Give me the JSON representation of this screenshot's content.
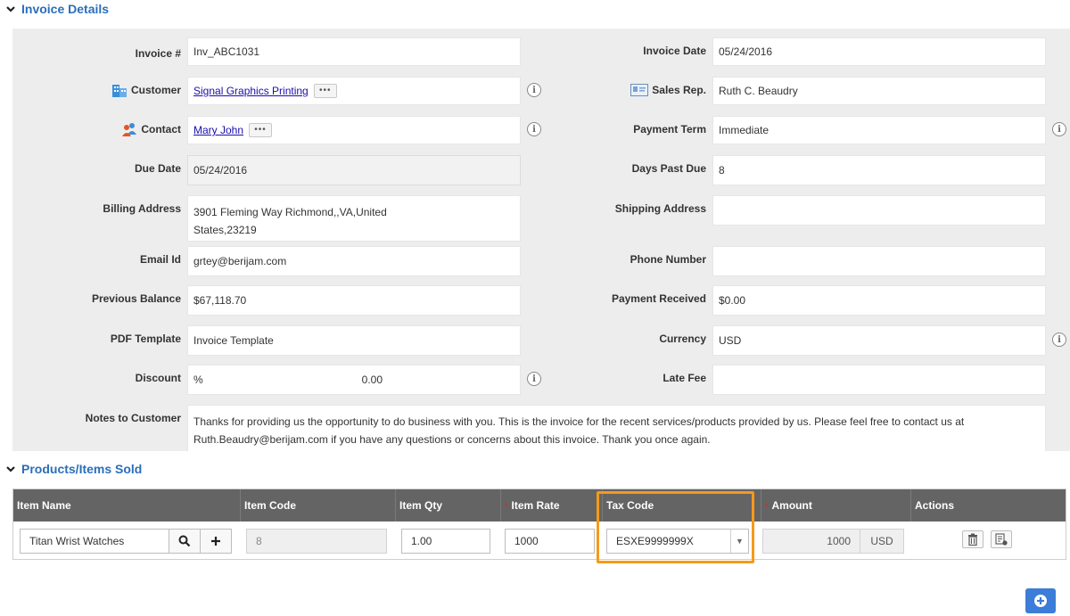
{
  "sections": {
    "invoice_details": "Invoice Details",
    "products_sold": "Products/Items Sold"
  },
  "invoice": {
    "invoice_no_label": "Invoice #",
    "invoice_no": "Inv_ABC1031",
    "invoice_date_label": "Invoice Date",
    "invoice_date": "05/24/2016",
    "customer_label": "Customer",
    "customer": "Signal Graphics Printing",
    "sales_rep_label": "Sales Rep.",
    "sales_rep": "Ruth C. Beaudry",
    "contact_label": "Contact",
    "contact": "Mary John",
    "payment_term_label": "Payment Term",
    "payment_term": "Immediate",
    "due_date_label": "Due Date",
    "due_date": "05/24/2016",
    "days_past_due_label": "Days Past Due",
    "days_past_due": "8",
    "billing_address_label": "Billing Address",
    "billing_address_line1": "3901 Fleming Way Richmond,,VA,United",
    "billing_address_line2": "States,23219",
    "shipping_address_label": "Shipping Address",
    "shipping_address": "",
    "email_label": "Email Id",
    "email": "grtey@berijam.com",
    "phone_label": "Phone Number",
    "phone": "",
    "prev_balance_label": "Previous Balance",
    "prev_balance": "$67,118.70",
    "payment_received_label": "Payment Received",
    "payment_received": "$0.00",
    "pdf_template_label": "PDF Template",
    "pdf_template": "Invoice Template",
    "currency_label": "Currency",
    "currency": "USD",
    "discount_label": "Discount",
    "discount_unit": "%",
    "discount_value": "0.00",
    "late_fee_label": "Late Fee",
    "late_fee": "",
    "notes_label": "Notes to Customer",
    "notes_line1": "Thanks for providing us the opportunity to do business with you. This is the invoice for the recent services/products provided by us. Please feel free to contact us at",
    "notes_line2": "Ruth.Beaudry@berijam.com if you have any questions or concerns about this invoice. Thank you once again."
  },
  "items_table": {
    "headers": {
      "item_name": "Item Name",
      "item_code": "Item Code",
      "item_qty": "Item Qty",
      "item_rate": "Item Rate",
      "tax_code": "Tax Code",
      "amount": "Amount",
      "actions": "Actions"
    },
    "row": {
      "item_name": "Titan Wrist Watches",
      "item_code": "8",
      "item_qty": "1.00",
      "item_rate": "1000",
      "tax_code": "ESXE9999999X",
      "amount": "1000",
      "amount_currency": "USD"
    }
  },
  "colors": {
    "accent": "#2a6ebb",
    "highlight": "#f59a1b",
    "header_bg": "#646464",
    "add_button": "#3b7dd8"
  },
  "icons": {
    "more": "•••",
    "info": "i",
    "search": "search-icon",
    "plus": "+",
    "dropdown": "▼"
  }
}
